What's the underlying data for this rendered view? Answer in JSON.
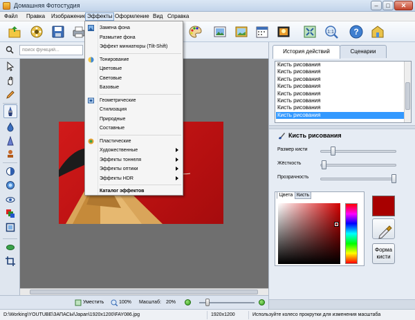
{
  "window": {
    "title": "Домашняя Фотостудия",
    "minimize_glyph": "–",
    "maximize_glyph": "□",
    "close_glyph": "✕"
  },
  "menu": [
    "Файл",
    "Правка",
    "Изображение",
    "Эффекты",
    "Оформление",
    "Вид",
    "Справка"
  ],
  "menu_active": "Эффекты",
  "search": {
    "placeholder": "поиск функций..."
  },
  "effects_menu": {
    "items": [
      {
        "label": "Замена фона",
        "icon": "background-replace-icon"
      },
      {
        "label": "Размытие фона"
      },
      {
        "label": "Эффект миниатюры (Tilt-Shift)"
      },
      {
        "label": "Тонирование",
        "icon": "toning-icon"
      },
      {
        "label": "Цветовые"
      },
      {
        "label": "Световые"
      },
      {
        "label": "Базовые"
      },
      {
        "label": "Геометрические",
        "icon": "geometric-icon"
      },
      {
        "label": "Стилизация"
      },
      {
        "label": "Природные"
      },
      {
        "label": "Составные"
      },
      {
        "label": "Пластические",
        "icon": "plastic-icon"
      },
      {
        "label": "Художественные",
        "submenu": true
      },
      {
        "label": "Эффекты тоннеля",
        "submenu": true
      },
      {
        "label": "Эффекты оптики",
        "submenu": true
      },
      {
        "label": "Эффекты HDR",
        "submenu": true
      },
      {
        "label": "Каталог эффектов",
        "bold": true
      }
    ]
  },
  "right_panel": {
    "tabs": [
      "История действий",
      "Сценарии"
    ],
    "history": [
      "Кисть рисования",
      "Кисть рисования",
      "Кисть рисования",
      "Кисть рисования",
      "Кисть рисования",
      "Кисть рисования",
      "Кисть рисования",
      "Кисть рисования"
    ],
    "history_selected_index": 7,
    "brush": {
      "title": "Кисть рисования",
      "size_label": "Размер кисти",
      "size_value": 0.15,
      "hardness_label": "Жёсткость",
      "hardness_value": 0.02,
      "opacity_label": "Прозрачность",
      "opacity_value": 1.0
    },
    "color_tabs": [
      "Цвета",
      "Кисть"
    ],
    "current_color": "#a80000",
    "shape_button": "Форма кисти"
  },
  "statusbar": {
    "fit_label": "Уместить",
    "zoom_100": "100%",
    "scale_label": "Масштаб:",
    "scale_value": "20%",
    "zoom_slider_value": 0.12
  },
  "bottom": {
    "path": "D:\\Working\\YOUTUBE\\ЗАПАСЫ\\Japan\\1920x1200\\FAY086.jpg",
    "size": "1920x1200",
    "hint": "Используйте колесо прокрутки для изменения масштаба"
  }
}
